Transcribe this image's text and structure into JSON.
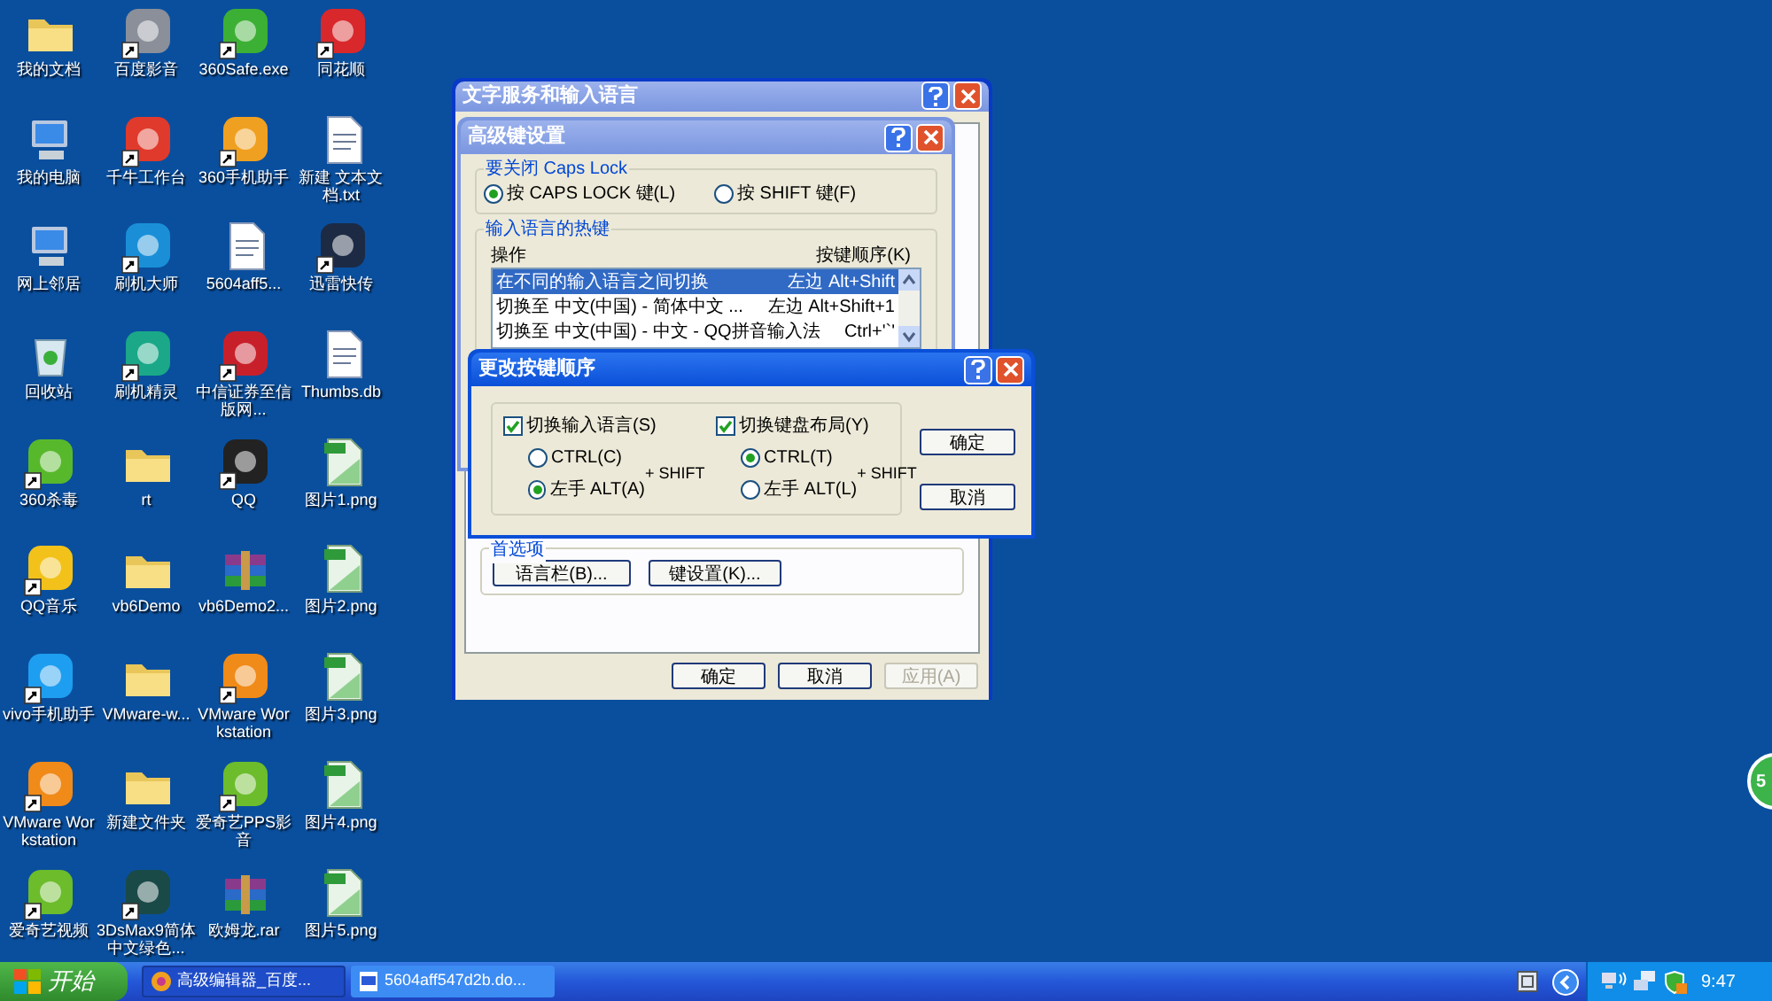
{
  "desktop_icons": [
    {
      "label": "我的文档",
      "kind": "folder",
      "shortcut": false
    },
    {
      "label": "百度影音",
      "kind": "app",
      "color": "#8a8f99",
      "shortcut": true
    },
    {
      "label": "360Safe.exe",
      "kind": "app",
      "color": "#3cb034",
      "shortcut": true
    },
    {
      "label": "同花顺",
      "kind": "app",
      "color": "#d8282c",
      "shortcut": true
    },
    {
      "label": "我的电脑",
      "kind": "computer",
      "shortcut": false
    },
    {
      "label": "千牛工作台",
      "kind": "app",
      "color": "#e03a2c",
      "shortcut": true
    },
    {
      "label": "360手机助手",
      "kind": "app",
      "color": "#f0a020",
      "shortcut": true
    },
    {
      "label": "新建 文本文档.txt",
      "kind": "document",
      "shortcut": false
    },
    {
      "label": "网上邻居",
      "kind": "computer",
      "shortcut": false
    },
    {
      "label": "刷机大师",
      "kind": "app",
      "color": "#1a8fd8",
      "shortcut": true
    },
    {
      "label": "5604aff5...",
      "kind": "document",
      "shortcut": false
    },
    {
      "label": "迅雷快传",
      "kind": "app",
      "color": "#1c2a44",
      "shortcut": true
    },
    {
      "label": "回收站",
      "kind": "recycle",
      "shortcut": false
    },
    {
      "label": "刷机精灵",
      "kind": "app",
      "color": "#1aa888",
      "shortcut": true
    },
    {
      "label": "中信证券至信版网...",
      "kind": "app",
      "color": "#c8202a",
      "shortcut": true
    },
    {
      "label": "Thumbs.db",
      "kind": "document",
      "shortcut": false
    },
    {
      "label": "360杀毒",
      "kind": "app",
      "color": "#58b82c",
      "shortcut": true
    },
    {
      "label": "rt",
      "kind": "folder",
      "shortcut": false
    },
    {
      "label": "QQ",
      "kind": "app",
      "color": "#222222",
      "shortcut": true
    },
    {
      "label": "图片1.png",
      "kind": "image",
      "shortcut": false
    },
    {
      "label": "QQ音乐",
      "kind": "app",
      "color": "#f2c21a",
      "shortcut": true
    },
    {
      "label": "vb6Demo",
      "kind": "folder",
      "shortcut": false
    },
    {
      "label": "vb6Demo2...",
      "kind": "archive",
      "shortcut": false
    },
    {
      "label": "图片2.png",
      "kind": "image",
      "shortcut": false
    },
    {
      "label": "vivo手机助手",
      "kind": "app",
      "color": "#1e9ef0",
      "shortcut": true
    },
    {
      "label": "VMware-w...",
      "kind": "folder",
      "shortcut": false
    },
    {
      "label": "VMware Workstation",
      "kind": "app",
      "color": "#f08a18",
      "shortcut": true
    },
    {
      "label": "图片3.png",
      "kind": "image",
      "shortcut": false
    },
    {
      "label": "VMware Workstation",
      "kind": "app",
      "color": "#f08a18",
      "shortcut": true
    },
    {
      "label": "新建文件夹",
      "kind": "folder",
      "shortcut": false
    },
    {
      "label": "爱奇艺PPS影音",
      "kind": "app",
      "color": "#6cbc2c",
      "shortcut": true
    },
    {
      "label": "图片4.png",
      "kind": "image",
      "shortcut": false
    },
    {
      "label": "爱奇艺视频",
      "kind": "app",
      "color": "#6cbc2c",
      "shortcut": true
    },
    {
      "label": "3DsMax9简体中文绿色...",
      "kind": "app",
      "color": "#1a4a48",
      "shortcut": true
    },
    {
      "label": "欧姆龙.rar",
      "kind": "archive",
      "shortcut": false
    },
    {
      "label": "图片5.png",
      "kind": "image",
      "shortcut": false
    }
  ],
  "main_dialog": {
    "title": "文字服务和输入语言",
    "group_label": "首选项",
    "group_buttons": [
      "语言栏(B)...",
      "键设置(K)..."
    ],
    "buttons": [
      {
        "label": "确定",
        "disabled": false
      },
      {
        "label": "取消",
        "disabled": false
      },
      {
        "label": "应用(A)",
        "disabled": true
      }
    ]
  },
  "advanced_dialog": {
    "title": "高级键设置",
    "caps_group": "要关闭 Caps Lock",
    "caps_options": [
      {
        "label": "按 CAPS LOCK 键(L)",
        "selected": true
      },
      {
        "label": "按 SHIFT 键(F)",
        "selected": false
      }
    ],
    "hotkey_group": "输入语言的热键",
    "columns": [
      "操作",
      "按键顺序(K)"
    ],
    "rows": [
      {
        "action": "在不同的输入语言之间切换",
        "keys": "左边 Alt+Shift",
        "selected": true
      },
      {
        "action": "切换至 中文(中国) - 简体中文 ...",
        "keys": "左边 Alt+Shift+1",
        "selected": false
      },
      {
        "action": "切换至 中文(中国) - 中文 - QQ拼音输入法",
        "keys": "Ctrl+'`'",
        "selected": false
      }
    ]
  },
  "key_sequence_dialog": {
    "title": "更改按键顺序",
    "sections": [
      {
        "label": "切换输入语言(S)",
        "checked": true,
        "options": [
          {
            "label": "CTRL(C)",
            "selected": false
          },
          {
            "label": "左手 ALT(A)",
            "selected": true
          }
        ],
        "suffix": "+ SHIFT"
      },
      {
        "label": "切换键盘布局(Y)",
        "checked": true,
        "options": [
          {
            "label": "CTRL(T)",
            "selected": true
          },
          {
            "label": "左手 ALT(L)",
            "selected": false
          }
        ],
        "suffix": "+ SHIFT"
      }
    ],
    "buttons": [
      "确定",
      "取消"
    ]
  },
  "floating_ball": {
    "text": "5"
  },
  "taskbar": {
    "start": "开始",
    "tasks": [
      {
        "label": "高级编辑器_百度...",
        "selected": false
      },
      {
        "label": "5604aff547d2b.do...",
        "selected": true
      }
    ],
    "clock": "9:47"
  }
}
